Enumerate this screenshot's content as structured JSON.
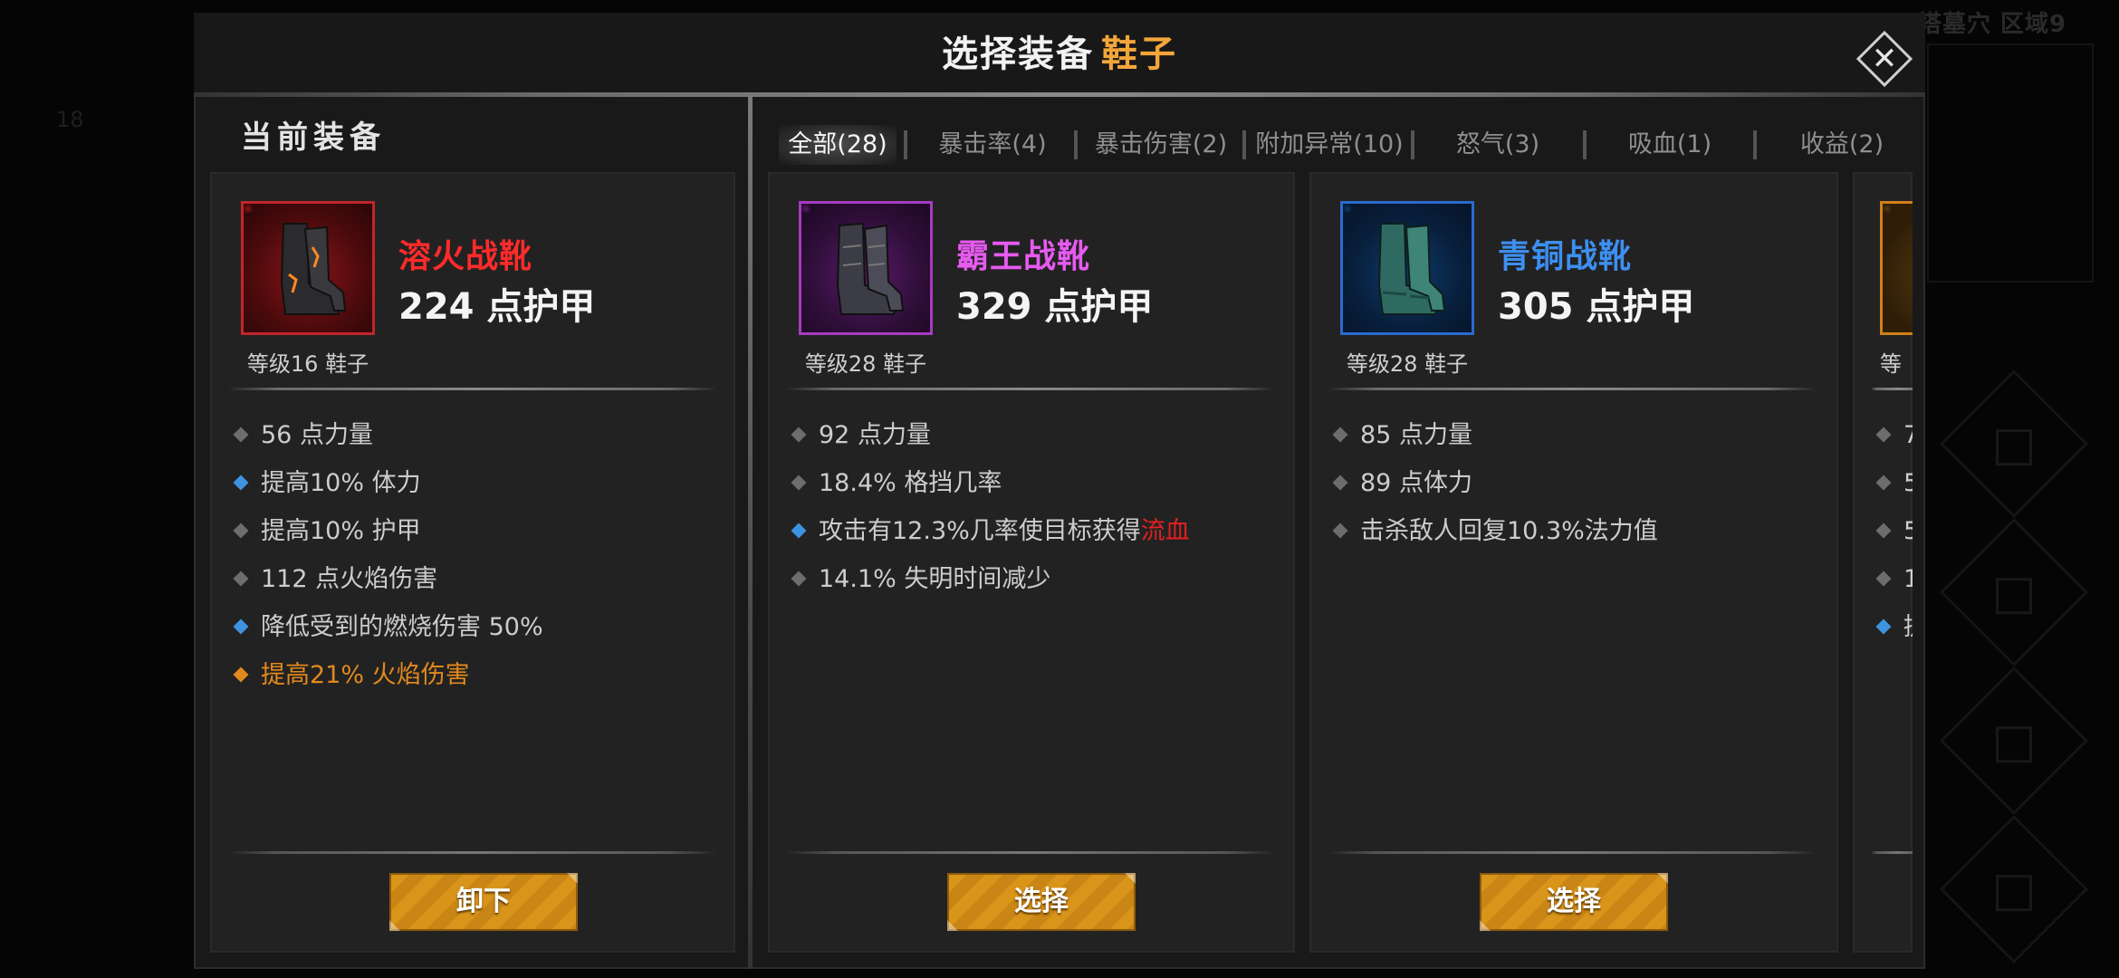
{
  "background": {
    "top_right_text": "塔墓穴 区域9",
    "left_number": "18"
  },
  "header": {
    "title_prefix": "选择装备",
    "title_accent": "鞋子",
    "close_icon": "close-icon"
  },
  "current_section": {
    "label": "当前装备",
    "item": {
      "name": "溶火战靴",
      "name_color": "#ff2a2a",
      "armor": "224 点护甲",
      "level": "等级16 鞋子",
      "frame_color": "#c0262a",
      "stats": [
        {
          "text": "56 点力量",
          "marker": "gray"
        },
        {
          "text": "提高10% 体力",
          "marker": "blue"
        },
        {
          "text": "提高10% 护甲",
          "marker": "gray"
        },
        {
          "text": "112 点火焰伤害",
          "marker": "gray"
        },
        {
          "text": "降低受到的燃烧伤害 50%",
          "marker": "blue"
        },
        {
          "text": "提高21% 火焰伤害",
          "marker": "orange"
        }
      ],
      "button": "卸下"
    }
  },
  "tabs": [
    {
      "label": "全部(28)",
      "active": true
    },
    {
      "label": "暴击率(4)",
      "active": false
    },
    {
      "label": "暴击伤害(2)",
      "active": false
    },
    {
      "label": "附加异常(10)",
      "active": false
    },
    {
      "label": "怒气(3)",
      "active": false
    },
    {
      "label": "吸血(1)",
      "active": false
    },
    {
      "label": "收益(2)",
      "active": false
    }
  ],
  "candidates": [
    {
      "name": "霸王战靴",
      "name_color": "#e65bf0",
      "armor": "329 点护甲",
      "level": "等级28 鞋子",
      "frame_color": "#a73bc0",
      "stats": [
        {
          "text": "92 点力量",
          "marker": "gray"
        },
        {
          "text": "18.4% 格挡几率",
          "marker": "gray"
        },
        {
          "text_before": "攻击有12.3%几率使目标获得",
          "text_red": "流血",
          "marker": "blue"
        },
        {
          "text": "14.1% 失明时间减少",
          "marker": "gray"
        }
      ],
      "button": "选择"
    },
    {
      "name": "青铜战靴",
      "name_color": "#3d8ff0",
      "armor": "305 点护甲",
      "level": "等级28 鞋子",
      "frame_color": "#2a6bd0",
      "stats": [
        {
          "text": "85 点力量",
          "marker": "gray"
        },
        {
          "text": "89 点体力",
          "marker": "gray"
        },
        {
          "text": "击杀敌人回复10.3%法力值",
          "marker": "gray"
        }
      ],
      "button": "选择"
    },
    {
      "partial": true,
      "level": "等",
      "frame_color": "#d0801a",
      "stats": [
        {
          "text": "7",
          "marker": "gray"
        },
        {
          "text": "5",
          "marker": "gray"
        },
        {
          "text": "5",
          "marker": "gray"
        },
        {
          "text": "1",
          "marker": "gray"
        },
        {
          "text": "提",
          "marker": "blue"
        }
      ]
    }
  ],
  "colors": {
    "accent": "#f3a63a",
    "button": "#d9951a"
  }
}
